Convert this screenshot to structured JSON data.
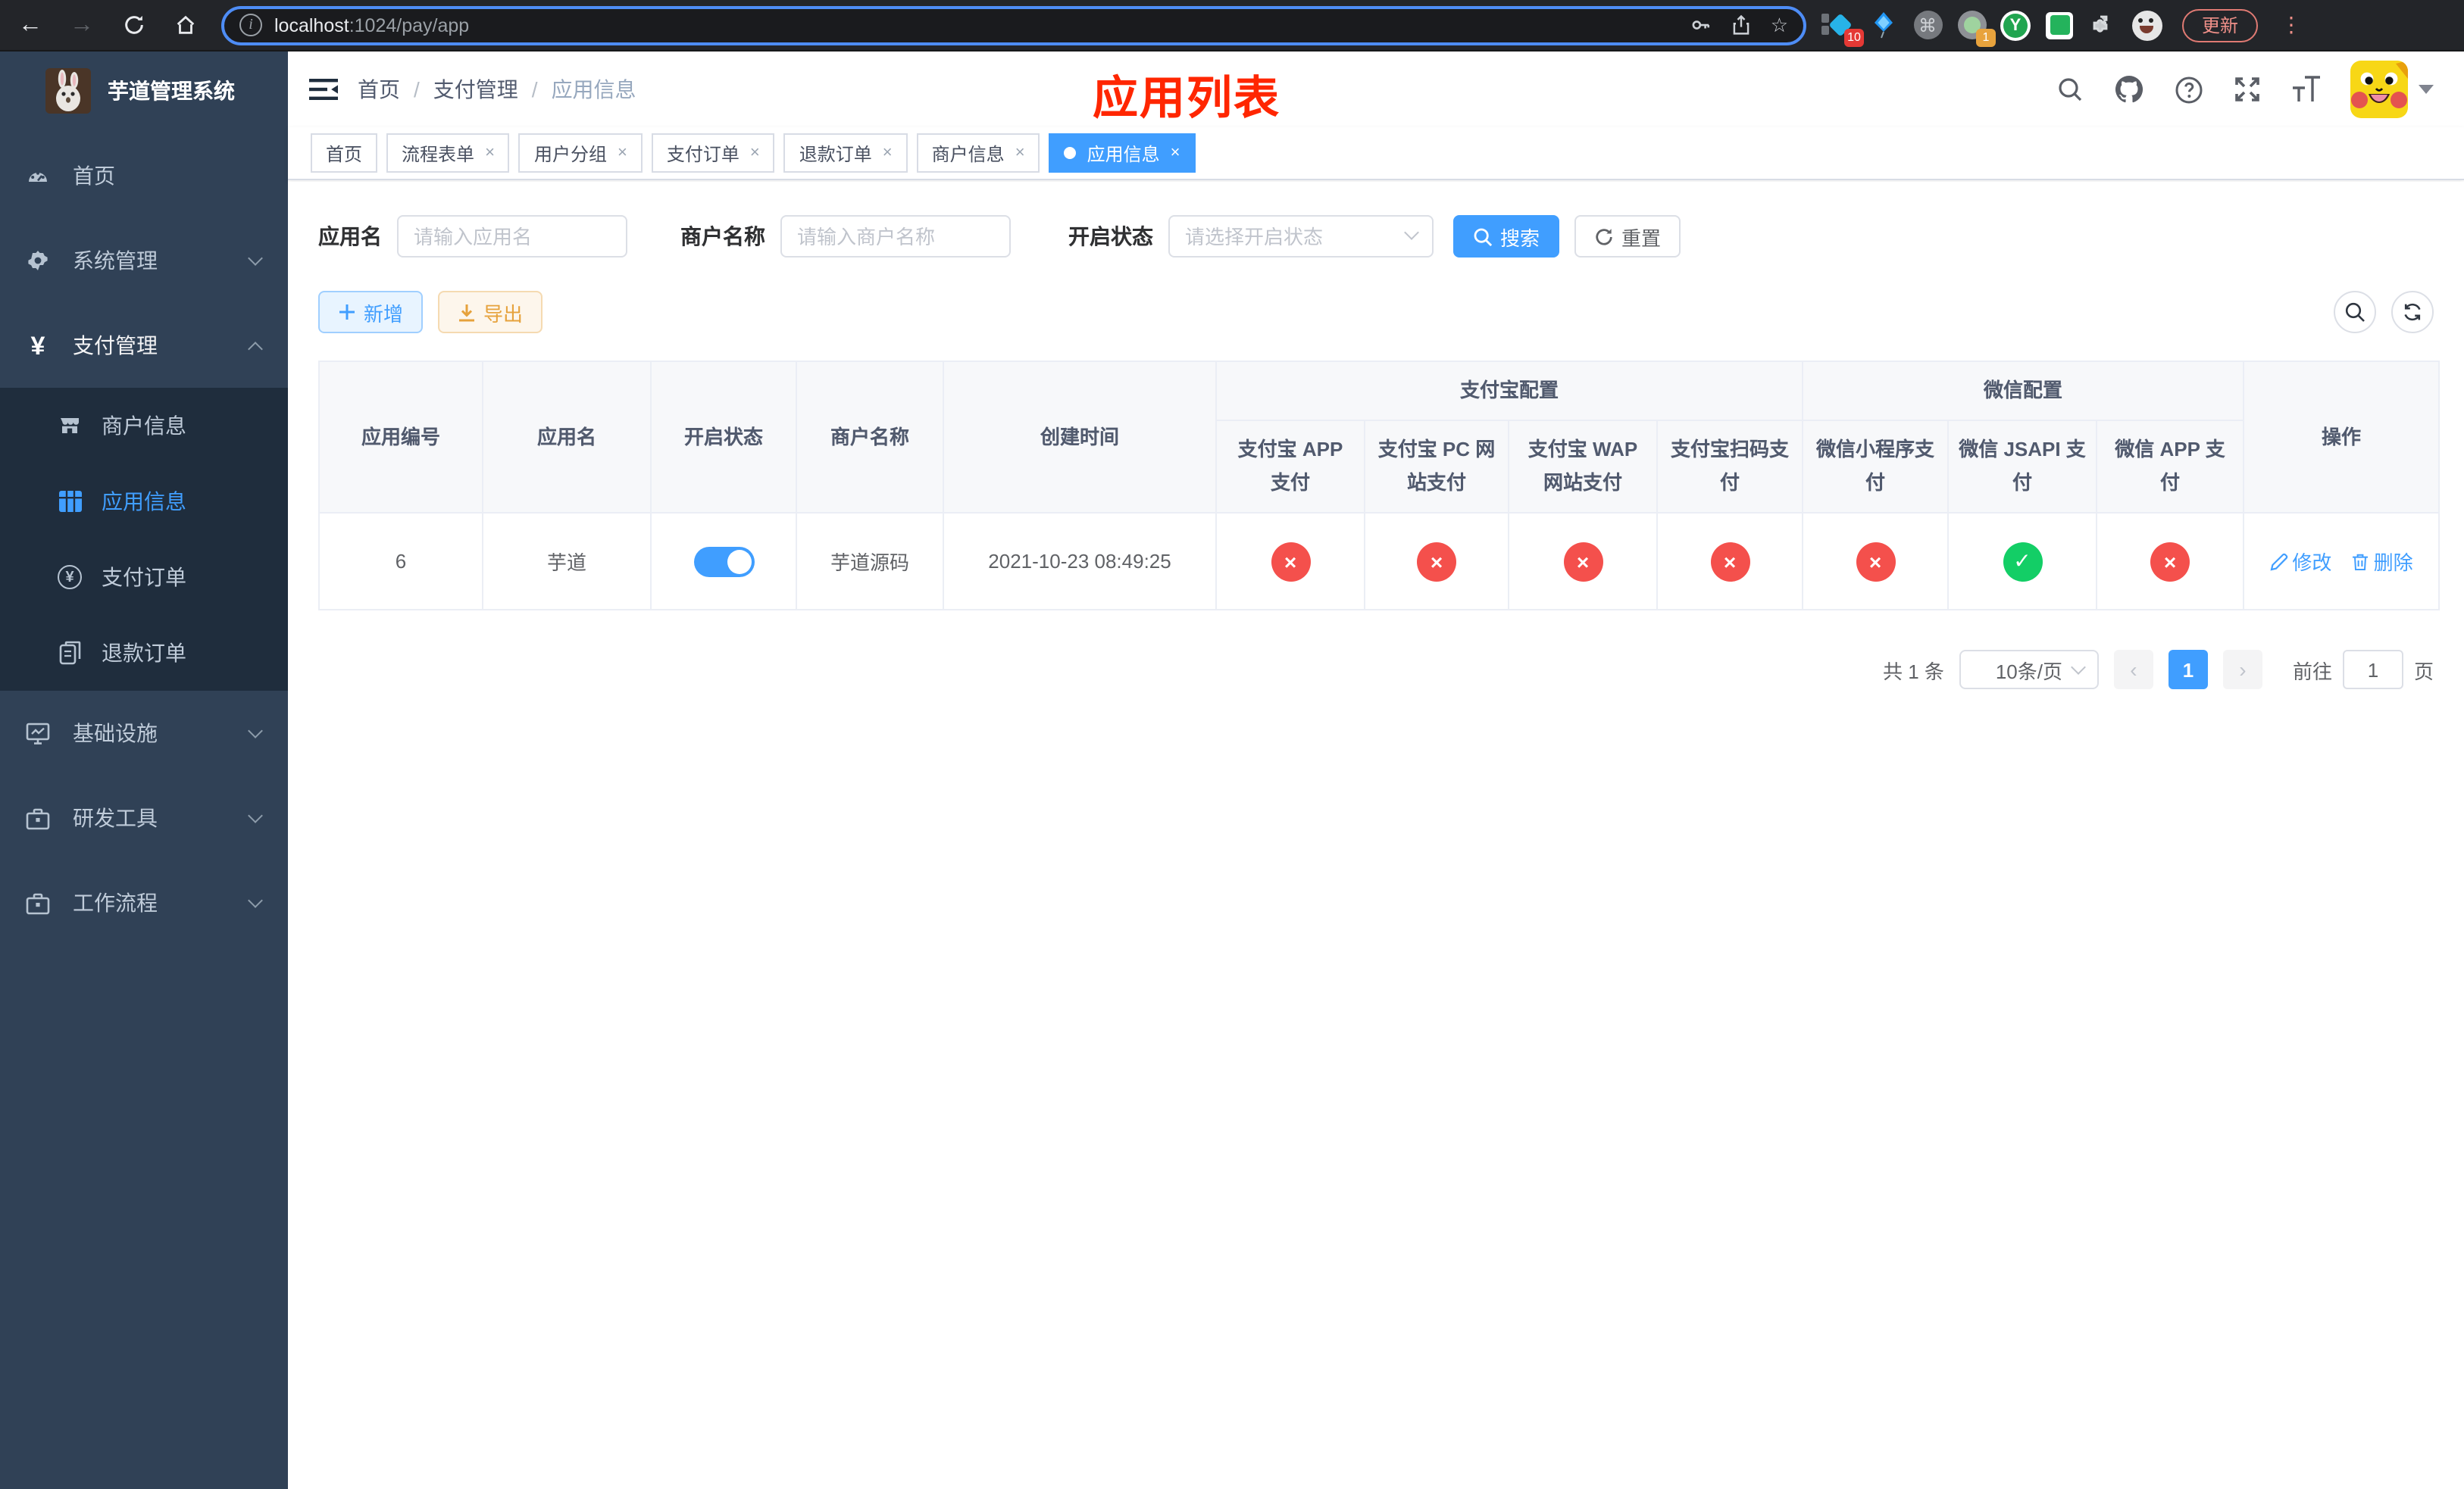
{
  "browser": {
    "url": {
      "host": "localhost",
      "path": ":1024/pay/app"
    },
    "update_label": "更新",
    "ext_badges": {
      "pin_count": "10",
      "session_count": "1"
    },
    "ext_y_letter": "Y"
  },
  "sidebar": {
    "logo_title": "芋道管理系统",
    "items": [
      {
        "label": "首页",
        "icon": "dashboard-icon"
      },
      {
        "label": "系统管理",
        "icon": "gear-icon",
        "expandable": true
      },
      {
        "label": "支付管理",
        "icon": "yen-icon",
        "expandable": true,
        "expanded": true,
        "children": [
          {
            "label": "商户信息",
            "icon": "shop-icon"
          },
          {
            "label": "应用信息",
            "icon": "grid-icon",
            "active": true
          },
          {
            "label": "支付订单",
            "icon": "yen-circle-icon"
          },
          {
            "label": "退款订单",
            "icon": "document-icon"
          }
        ]
      },
      {
        "label": "基础设施",
        "icon": "monitor-icon",
        "expandable": true
      },
      {
        "label": "研发工具",
        "icon": "toolbox-icon",
        "expandable": true
      },
      {
        "label": "工作流程",
        "icon": "toolbox-icon",
        "expandable": true
      }
    ]
  },
  "header": {
    "breadcrumb": [
      {
        "label": "首页"
      },
      {
        "label": "支付管理"
      },
      {
        "label": "应用信息"
      }
    ],
    "breadcrumb_separator": "/",
    "annotation": "应用列表"
  },
  "tabs": [
    {
      "label": "首页",
      "closable": false,
      "active": false
    },
    {
      "label": "流程表单",
      "closable": true,
      "active": false
    },
    {
      "label": "用户分组",
      "closable": true,
      "active": false
    },
    {
      "label": "支付订单",
      "closable": true,
      "active": false
    },
    {
      "label": "退款订单",
      "closable": true,
      "active": false
    },
    {
      "label": "商户信息",
      "closable": true,
      "active": false
    },
    {
      "label": "应用信息",
      "closable": true,
      "active": true
    }
  ],
  "filters": {
    "fields": [
      {
        "label": "应用名",
        "placeholder": "请输入应用名",
        "type": "text"
      },
      {
        "label": "商户名称",
        "placeholder": "请输入商户名称",
        "type": "text"
      },
      {
        "label": "开启状态",
        "placeholder": "请选择开启状态",
        "type": "select"
      }
    ],
    "search_label": "搜索",
    "reset_label": "重置"
  },
  "toolbar": {
    "add_label": "新增",
    "export_label": "导出"
  },
  "table": {
    "columns": {
      "id": "应用编号",
      "name": "应用名",
      "enabled": "开启状态",
      "merchant": "商户名称",
      "created": "创建时间",
      "alipay_group": "支付宝配置",
      "wechat_group": "微信配置",
      "alipay_app": "支付宝 APP 支付",
      "alipay_pc": "支付宝 PC 网站支付",
      "alipay_wap": "支付宝 WAP 网站支付",
      "alipay_qr": "支付宝扫码支付",
      "wx_lite": "微信小程序支付",
      "wx_jsapi": "微信 JSAPI 支付",
      "wx_app": "微信 APP 支付",
      "actions": "操作"
    },
    "rows": [
      {
        "id": "6",
        "name": "芋道",
        "enabled": true,
        "merchant": "芋道源码",
        "created": "2021-10-23 08:49:25",
        "statuses": {
          "alipay_app": false,
          "alipay_pc": false,
          "alipay_wap": false,
          "alipay_qr": false,
          "wx_lite": false,
          "wx_jsapi": true,
          "wx_app": false
        },
        "edit_label": "修改",
        "delete_label": "删除"
      }
    ]
  },
  "pagination": {
    "total_text": "共 1 条",
    "page_size": "10条/页",
    "current_page": "1",
    "goto_label": "前往",
    "goto_value": "1",
    "page_suffix": "页"
  },
  "colors": {
    "primary": "#409eff",
    "danger": "#f4504c",
    "success": "#13ce66",
    "warning": "#e6a23c",
    "annotation": "#ff2600",
    "sidebar_bg": "#304156",
    "submenu_bg": "#1f2d3d"
  }
}
